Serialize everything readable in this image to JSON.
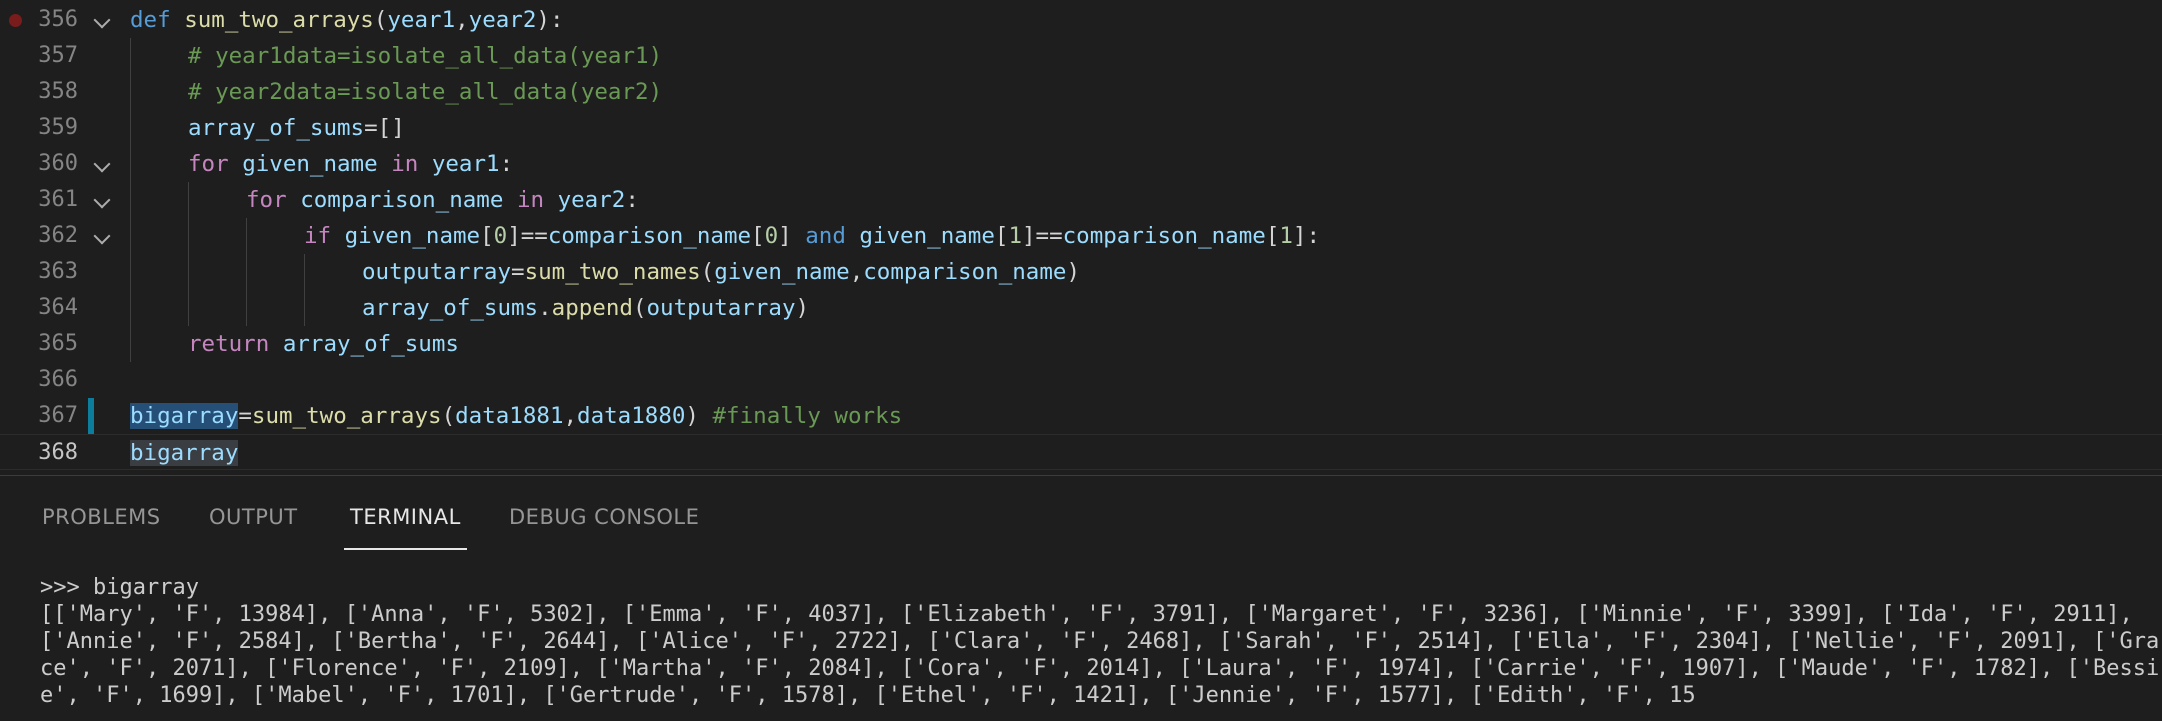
{
  "editor": {
    "lines": [
      {
        "num": "356"
      },
      {
        "num": "357"
      },
      {
        "num": "358"
      },
      {
        "num": "359"
      },
      {
        "num": "360"
      },
      {
        "num": "361"
      },
      {
        "num": "362"
      },
      {
        "num": "363"
      },
      {
        "num": "364"
      },
      {
        "num": "365"
      },
      {
        "num": "366"
      },
      {
        "num": "367"
      },
      {
        "num": "368"
      }
    ],
    "tokens": {
      "def": "def",
      "fn_sum_two_arrays": "sum_two_arrays",
      "year1": "year1",
      "year2": "year2",
      "comment1": "# year1data=isolate_all_data(year1)",
      "comment2": "# year2data=isolate_all_data(year2)",
      "array_of_sums": "array_of_sums",
      "for": "for",
      "given_name": "given_name",
      "in": "in",
      "comparison_name": "comparison_name",
      "if": "if",
      "and": "and",
      "zero": "0",
      "one": "1",
      "outputarray": "outputarray",
      "fn_sum_two_names": "sum_two_names",
      "append": "append",
      "return": "return",
      "bigarray": "bigarray",
      "data1881": "data1881",
      "data1880": "data1880",
      "comment3": "#finally works"
    }
  },
  "panel": {
    "tabs": [
      {
        "label": "PROBLEMS"
      },
      {
        "label": "OUTPUT"
      },
      {
        "label": "TERMINAL"
      },
      {
        "label": "DEBUG CONSOLE"
      }
    ],
    "terminal": {
      "prompt": ">>> bigarray",
      "output": "[['Mary', 'F', 13984], ['Anna', 'F', 5302], ['Emma', 'F', 4037], ['Elizabeth', 'F', 3791], ['Margaret', 'F', 3236], ['Minnie', 'F', 3399], ['Ida', 'F', 2911], ['Annie', 'F', 2584], ['Bertha', 'F', 2644], ['Alice', 'F', 2722], ['Clara', 'F', 2468], ['Sarah', 'F', 2514], ['Ella', 'F', 2304], ['Nellie', 'F', 2091], ['Grace', 'F', 2071], ['Florence', 'F', 2109], ['Martha', 'F', 2084], ['Cora', 'F', 2014], ['Laura', 'F', 1974], ['Carrie', 'F', 1907], ['Maude', 'F', 1782], ['Bessie', 'F', 1699], ['Mabel', 'F', 1701], ['Gertrude', 'F', 1578], ['Ethel', 'F', 1421], ['Jennie', 'F', 1577], ['Edith', 'F', 15"
    }
  }
}
